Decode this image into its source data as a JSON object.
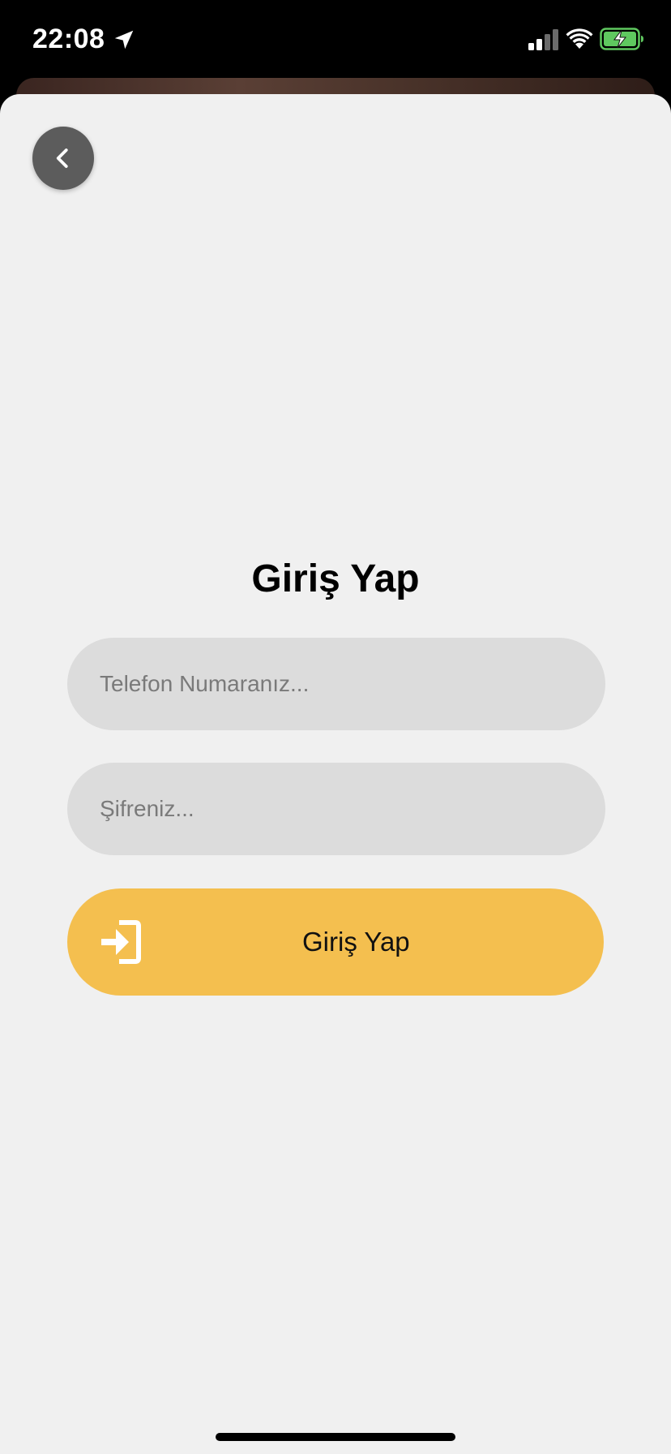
{
  "status_bar": {
    "time": "22:08",
    "icons": [
      "location-arrow-icon",
      "cellular-signal-icon",
      "wifi-icon",
      "battery-charging-icon"
    ],
    "battery_color": "#5fc85f"
  },
  "header": {
    "back_icon": "chevron-left-icon"
  },
  "login": {
    "title": "Giriş Yap",
    "phone_placeholder": "Telefon Numaranız...",
    "password_placeholder": "Şifreniz...",
    "submit_label": "Giriş Yap",
    "submit_icon": "sign-in-icon",
    "accent_color": "#f4bf4f"
  }
}
